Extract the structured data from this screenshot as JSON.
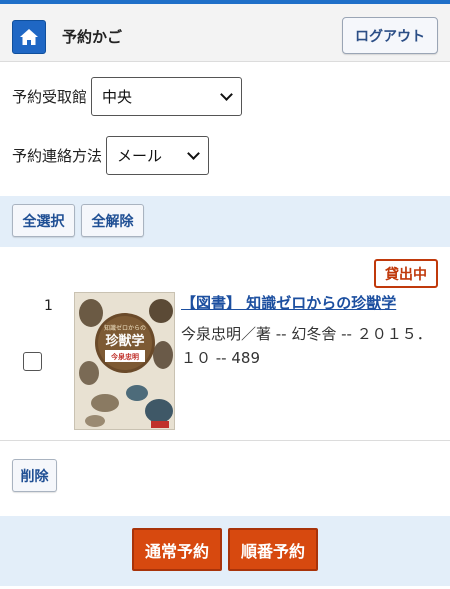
{
  "header": {
    "title": "予約かご",
    "logout_label": "ログアウト"
  },
  "pickup": {
    "label": "予約受取館",
    "selected": "中央"
  },
  "contact": {
    "label": "予約連絡方法",
    "selected": "メール"
  },
  "toolbar": {
    "select_all_label": "全選択",
    "deselect_all_label": "全解除",
    "delete_label": "削除"
  },
  "items": [
    {
      "number": "1",
      "status": "貸出中",
      "title": "【図書】 知識ゼロからの珍獣学",
      "info": "今泉忠明／著 -- 幻冬舎 -- ２０１５．１０ -- 489",
      "checked": false,
      "cover_title": "珍獣学",
      "cover_subtitle": "知識ゼロからの",
      "cover_author": "今泉忠明"
    }
  ],
  "actions": {
    "normal_reserve_label": "通常予約",
    "order_reserve_label": "順番予約"
  },
  "colors": {
    "accent_blue": "#1f67c4",
    "status_red": "#c0390b",
    "action_orange": "#d7490f",
    "band_blue": "#e3eef9"
  }
}
